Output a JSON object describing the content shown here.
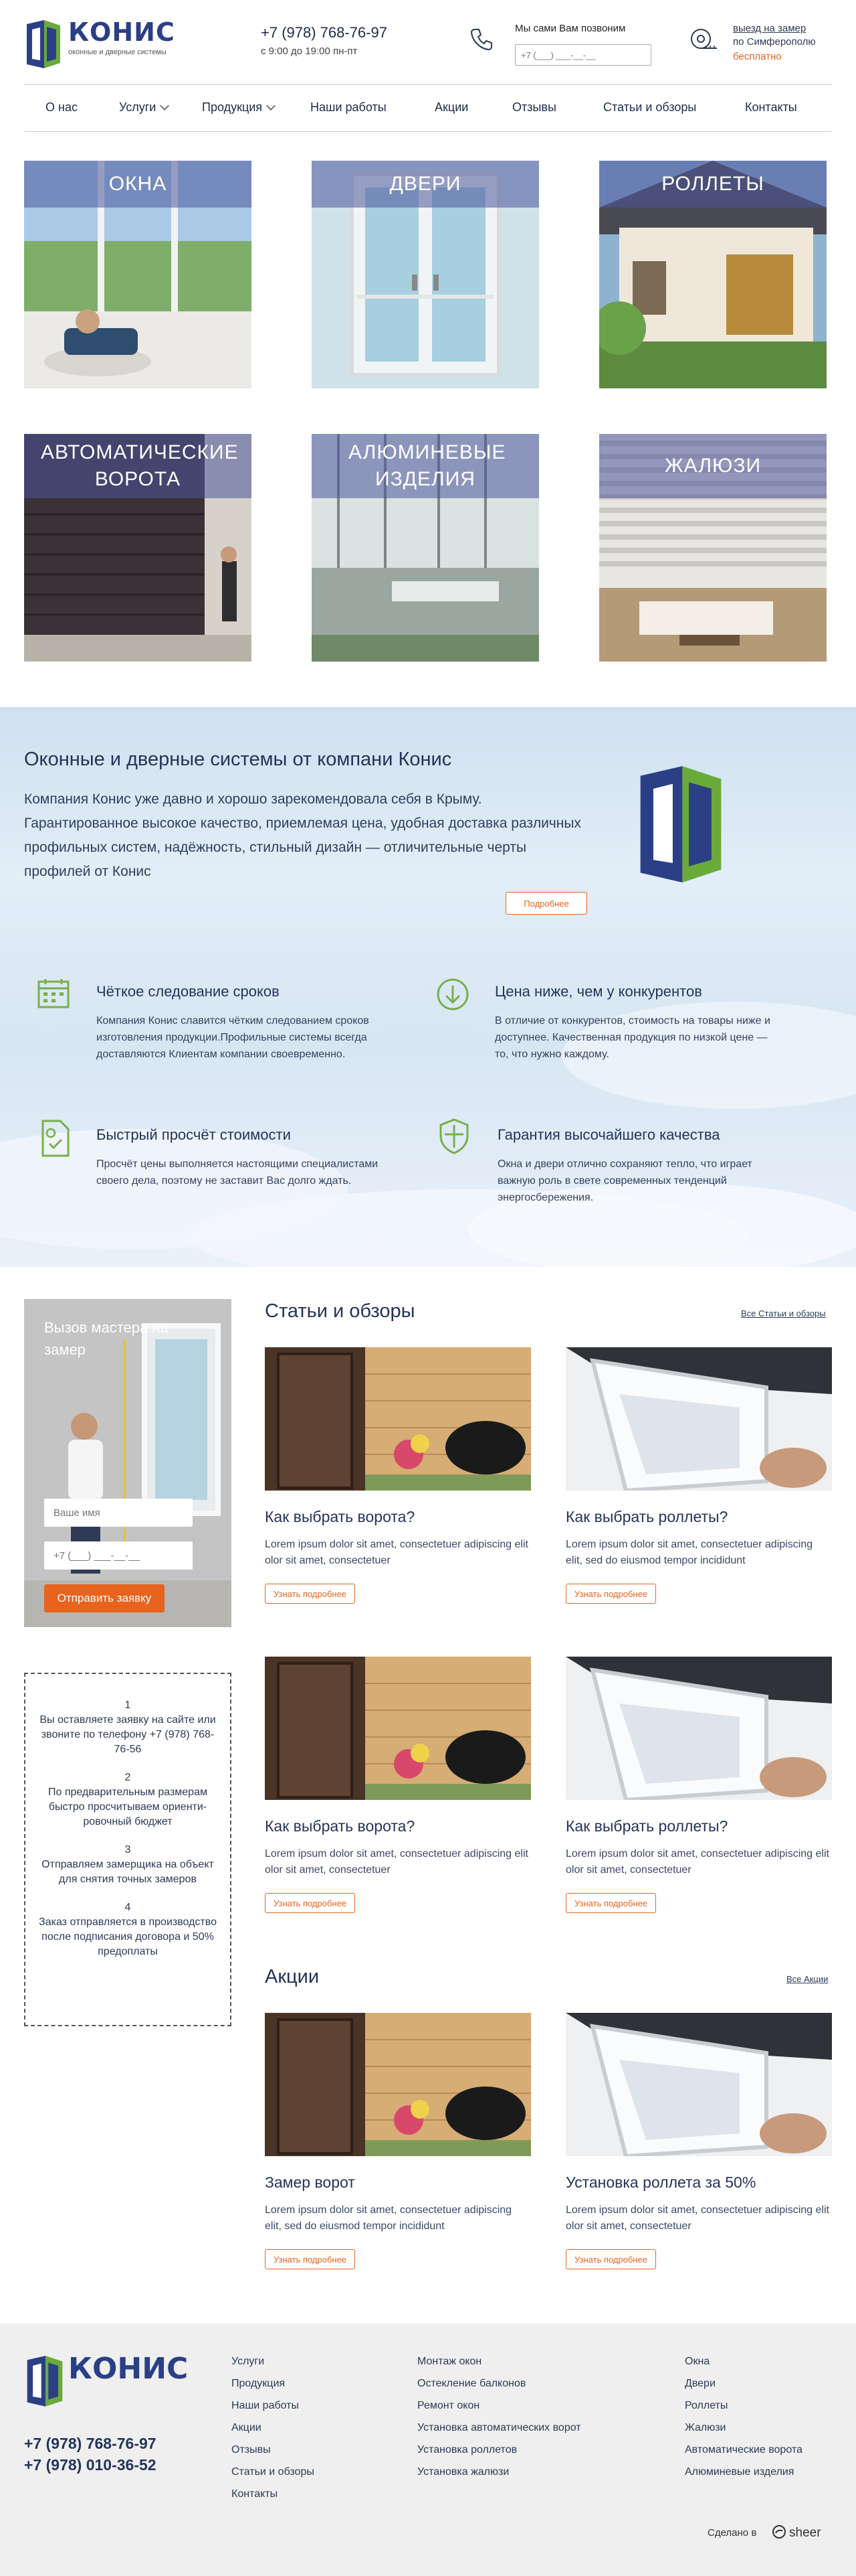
{
  "header": {
    "logo_text": "КОНИС",
    "logo_subtitle": "оконные и дверные системы",
    "phone": "+7 (978) 768-76-97",
    "hours": "с 9:00 до 19:00 пн-пт",
    "callback_title": "Мы сами Вам позвоним",
    "callback_placeholder": "+7 (___) ___-__-__",
    "measure_line1": "выезд на замер",
    "measure_line2": "по Симферополю",
    "measure_line3": "бесплатно",
    "accent_color": "#e8631e",
    "brand_color": "#2b3f86"
  },
  "nav": {
    "items": [
      {
        "label": "О нас"
      },
      {
        "label": "Услуги"
      },
      {
        "label": "Продукция"
      },
      {
        "label": "Наши работы"
      },
      {
        "label": "Акции"
      },
      {
        "label": "Отзывы"
      },
      {
        "label": "Статьи и обзоры"
      },
      {
        "label": "Контакты"
      }
    ]
  },
  "categories": [
    {
      "label": "ОКНА"
    },
    {
      "label": "ДВЕРИ"
    },
    {
      "label": "РОЛЛЕТЫ"
    },
    {
      "label": "АВТОМАТИЧЕСКИЕ ВОРОТА"
    },
    {
      "label": "АЛЮМИНЕВЫЕ ИЗДЕЛИЯ"
    },
    {
      "label": "ЖАЛЮЗИ"
    }
  ],
  "about": {
    "title": "Оконные и дверные системы от компани Конис",
    "text": "Компания Конис уже давно и хорошо зарекомендовала себя в Крыму. Гарантированное высокое качество, приемлемая цена, удобная доставка различных профильных систем, надёжность, стильный дизайн — отличительные черты профилей от Конис",
    "button": "Подробнее"
  },
  "features": [
    {
      "title": "Чёткое следование сроков",
      "text": "Компания Конис славится чётким следованием сроков изготовления продукции.Профильные системы всегда доставляются Клиентам компании своевременно.",
      "icon": "calendar-icon"
    },
    {
      "title": "Цена ниже, чем у конкурентов",
      "text": "В отличие от конкурентов, стоимость на товары ниже и доступнее. Качественная продукция по низкой цене — то, что нужно каждому.",
      "icon": "arrow-down-circle-icon"
    },
    {
      "title": "Быстрый просчёт стоимости",
      "text": "Просчёт цены выполняется настоящими специалистами своего дела, поэтому не заставит Вас долго ждать.",
      "icon": "document-check-icon"
    },
    {
      "title": "Гарантия высочайшего качества",
      "text": "Окна и двери отлично сохраняют тепло, что играет важную роль в свете современных тенденций энергосбережения.",
      "icon": "shield-icon"
    }
  ],
  "callcard": {
    "title": "Вызов мастера на замер",
    "name_placeholder": "Ваше имя",
    "phone_placeholder": "+7 (___) ___-__-__",
    "button": "Отправить заявку"
  },
  "steps": [
    {
      "num": "1",
      "text": "Вы оставляете заявку на сайте или звоните по телефону +7 (978) 768-76-56"
    },
    {
      "num": "2",
      "text": "По предварительным размерам быстро просчитываем ориенти-ровочный бюджет"
    },
    {
      "num": "3",
      "text": "Отправляем замерщика на объект для снятия точных замеров"
    },
    {
      "num": "4",
      "text": "Заказ отправляется в производство после подписания договора и 50% предоплаты"
    }
  ],
  "articles": {
    "title": "Статьи и обзоры",
    "all_link": "Все Статьи и обзоры",
    "items": [
      {
        "title": "Как выбрать ворота?",
        "text": "Lorem ipsum dolor sit amet, consectetuer adipiscing elit olor sit amet, consectetuer",
        "button": "Узнать подробнее"
      },
      {
        "title": "Как выбрать роллеты?",
        "text": "Lorem ipsum dolor sit amet, consectetuer adipiscing elit, sed do eiusmod tempor incididunt",
        "button": "Узнать подробнее"
      },
      {
        "title": "Как выбрать ворота?",
        "text": "Lorem ipsum dolor sit amet, consectetuer adipiscing elit olor sit amet, consectetuer",
        "button": "Узнать подробнее"
      },
      {
        "title": "Как выбрать роллеты?",
        "text": "Lorem ipsum dolor sit amet, consectetuer adipiscing elit olor sit amet, consectetuer",
        "button": "Узнать подробнее"
      }
    ]
  },
  "promos": {
    "title": "Акции",
    "all_link": "Все Акции",
    "items": [
      {
        "title": "Замер ворот",
        "text": "Lorem ipsum dolor sit amet, consectetuer adipiscing elit, sed do eiusmod tempor incididunt",
        "button": "Узнать подробнее"
      },
      {
        "title": "Установка роллета за 50%",
        "text": "Lorem ipsum dolor sit amet, consectetuer adipiscing elit olor sit amet, consectetuer",
        "button": "Узнать подробнее"
      }
    ]
  },
  "footer": {
    "logo_text": "КОНИС",
    "phone1": "+7 (978) 768-76-97",
    "phone2": "+7 (978) 010-36-52",
    "col1": [
      "Услуги",
      "Продукция",
      "Наши работы",
      "Акции",
      "Отзывы",
      "Статьи и обзоры",
      "Контакты"
    ],
    "col2": [
      "Монтаж окон",
      "Остекление балконов",
      "Ремонт окон",
      "Установка автоматических ворот",
      "Установка роллетов",
      "Установка жалюзи"
    ],
    "col3": [
      "Окна",
      "Двери",
      "Роллеты",
      "Жалюзи",
      "Автоматические ворота",
      "Алюминевые изделия"
    ],
    "made_by": "Сделано в",
    "studio": "sheer"
  }
}
